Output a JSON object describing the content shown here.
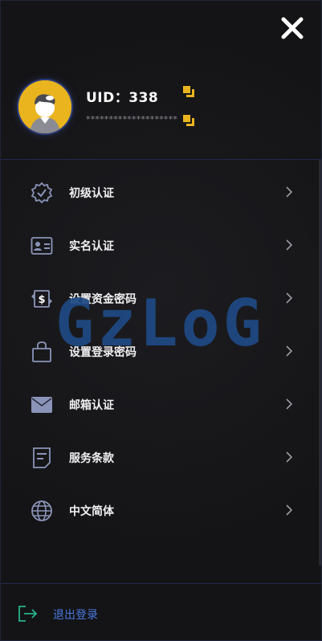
{
  "profile": {
    "uid_label": "UID：338",
    "masked_secret": "********************",
    "avatar_icon": "user-avatar-icon"
  },
  "menu": [
    {
      "label": "初级认证",
      "icon": "verified-badge-icon"
    },
    {
      "label": "实名认证",
      "icon": "id-card-icon"
    },
    {
      "label": "设置资金密码",
      "icon": "money-exchange-icon"
    },
    {
      "label": "设置登录密码",
      "icon": "lock-bag-icon"
    },
    {
      "label": "邮箱认证",
      "icon": "mail-icon"
    },
    {
      "label": "服务条款",
      "icon": "document-icon"
    },
    {
      "label": "中文简体",
      "icon": "globe-icon"
    }
  ],
  "logout": {
    "label": "退出登录",
    "icon": "logout-icon"
  },
  "watermark": "GzLoG",
  "colors": {
    "accent": "#eab41e",
    "link": "#4a78e0",
    "watermark": "#1f4a86",
    "logout_icon": "#27b38a"
  }
}
